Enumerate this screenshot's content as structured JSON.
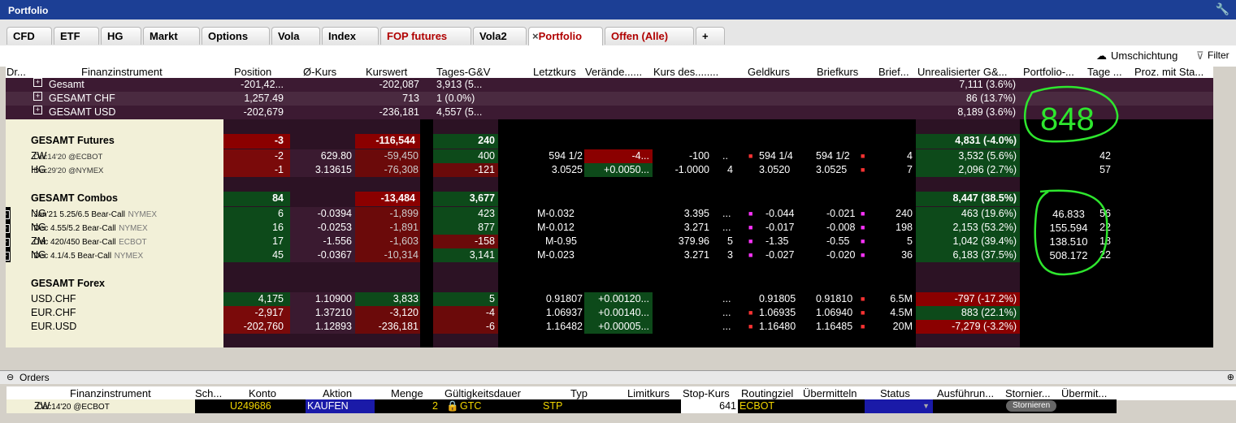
{
  "window": {
    "title": "Portfolio",
    "wrench_icon": "wrench-icon"
  },
  "tabs": [
    {
      "label": "CFD"
    },
    {
      "label": "ETF"
    },
    {
      "label": "HG"
    },
    {
      "label": "Markt"
    },
    {
      "label": "Options"
    },
    {
      "label": "Vola"
    },
    {
      "label": "Index"
    },
    {
      "label": "FOP futures"
    },
    {
      "label": "Vola2"
    },
    {
      "label": "Portfolio"
    },
    {
      "label": "Offen (Alle)"
    },
    {
      "label": "+"
    }
  ],
  "toolbar": {
    "umschichtung": "Umschichtung",
    "filter": "Filter"
  },
  "columns": [
    "Dr...",
    "Finanzinstrument",
    "Position",
    "Ø-Kurs",
    "Kurswert",
    "Tages-G&V",
    "Letztkurs",
    "Verände......",
    "Kurs des........",
    "Geldkurs",
    "Briefkurs",
    "Brief...",
    "Unrealisierter G&...",
    "Portfolio-...",
    "Tage ...",
    "Proz. mit Sta..."
  ],
  "summary": [
    {
      "label": "Gesamt",
      "position": "-201,42...",
      "kurswert": "-202,087",
      "tages": "3,913 (5...",
      "unreal": "7,111 (3.6%)"
    },
    {
      "label": "GESAMT   CHF",
      "position": "1,257.49",
      "kurswert": "713",
      "tages": "1 (0.0%)",
      "unreal": "86 (13.7%)"
    },
    {
      "label": "GESAMT   USD",
      "position": "-202,679",
      "kurswert": "-236,181",
      "tages": "4,557 (5...",
      "unreal": "8,189 (3.6%)"
    }
  ],
  "futures": {
    "title": "GESAMT Futures",
    "position": "-3",
    "kurswert": "-116,544",
    "tages": "240",
    "unreal": "4,831 (-4.0%)",
    "rows": [
      {
        "sym": "ZW",
        "desc": "Dec14'20 @ECBOT",
        "pos": "-2",
        "avg": "629.80",
        "kw": "-59,450",
        "tg": "400",
        "last": "594 1/2",
        "chg": "-4...",
        "kd": "-100",
        "bid": "594 1/4",
        "ask": "594 1/2",
        "bs": "4",
        "unreal": "3,532 (5.6%)",
        "tage": "42"
      },
      {
        "sym": "HG",
        "desc": "Dec29'20 @NYMEX",
        "pos": "-1",
        "avg": "3.13615",
        "kw": "-76,308",
        "tg": "-121",
        "last": "3.0525",
        "chg": "+0.0050...",
        "kd": "-1.0000",
        "kd2": "4",
        "bid": "3.0520",
        "ask": "3.0525",
        "bs": "7",
        "unreal": "2,096 (2.7%)",
        "tage": "57"
      }
    ]
  },
  "combos": {
    "title": "GESAMT Combos",
    "position": "84",
    "kurswert": "-13,484",
    "tages": "3,677",
    "unreal": "8,447 (38.5%)",
    "rows": [
      {
        "sym": "NG",
        "desc": "Jan'21 5.25/6.5 Bear-Call",
        "ex": "NYMEX",
        "pos": "6",
        "avg": "-0.0394",
        "kw": "-1,899",
        "tg": "423",
        "last": "M-0.032",
        "kd": "3.395",
        "kd2": "...",
        "bid": "-0.044",
        "ask": "-0.021",
        "bs": "240",
        "unreal": "463 (19.6%)",
        "tage": "56"
      },
      {
        "sym": "NG",
        "desc": "Dec 4.55/5.2 Bear-Call",
        "ex": "NYMEX",
        "pos": "16",
        "avg": "-0.0253",
        "kw": "-1,891",
        "tg": "877",
        "last": "M-0.012",
        "kd": "3.271",
        "kd2": "...",
        "bid": "-0.017",
        "ask": "-0.008",
        "bs": "198",
        "unreal": "2,153 (53.2%)",
        "tage": "22"
      },
      {
        "sym": "ZM",
        "desc": "Dec 420/450 Bear-Call",
        "ex": "ECBOT",
        "pos": "17",
        "avg": "-1.556",
        "kw": "-1,603",
        "tg": "-158",
        "last": "M-0.95",
        "kd": "379.96",
        "kd2": "5",
        "bid": "-1.35",
        "ask": "-0.55",
        "bs": "5",
        "unreal": "1,042 (39.4%)",
        "tage": "18"
      },
      {
        "sym": "NG",
        "desc": "Dec 4.1/4.5 Bear-Call",
        "ex": "NYMEX",
        "pos": "45",
        "avg": "-0.0367",
        "kw": "-10,314",
        "tg": "3,141",
        "last": "M-0.023",
        "kd": "3.271",
        "kd2": "3",
        "bid": "-0.027",
        "ask": "-0.020",
        "bs": "36",
        "unreal": "6,183 (37.5%)",
        "tage": "22"
      }
    ]
  },
  "forex": {
    "title": "GESAMT Forex",
    "rows": [
      {
        "sym": "USD.CHF",
        "pos": "4,175",
        "avg": "1.10900",
        "kw": "3,833",
        "tg": "5",
        "last": "0.91807",
        "chg": "+0.00120...",
        "kd2": "...",
        "bid": "0.91805",
        "ask": "0.91810",
        "bs": "6.5M",
        "unreal": "-797 (-17.2%)"
      },
      {
        "sym": "EUR.CHF",
        "pos": "-2,917",
        "avg": "1.37210",
        "kw": "-3,120",
        "tg": "-4",
        "last": "1.06937",
        "chg": "+0.00140...",
        "kd2": "...",
        "bid": "1.06935",
        "ask": "1.06940",
        "bs": "4.5M",
        "unreal": "883 (22.1%)"
      },
      {
        "sym": "EUR.USD",
        "pos": "-202,760",
        "avg": "1.12893",
        "kw": "-236,181",
        "tg": "-6",
        "last": "1.16482",
        "chg": "+0.00005...",
        "kd2": "...",
        "bid": "1.16480",
        "ask": "1.16485",
        "bs": "20M",
        "unreal": "-7,279 (-3.2%)"
      }
    ]
  },
  "annotations": {
    "total": "848",
    "portfolio_values": [
      "46.833",
      "155.594",
      "138.510",
      "508.172"
    ]
  },
  "orders": {
    "title": "Orders",
    "columns": [
      "Finanzinstrument",
      "Sch...",
      "Konto",
      "Aktion",
      "Menge",
      "Gültigkeitsdauer",
      "Typ",
      "Limitkurs",
      "Stop-Kurs",
      "Routingziel",
      "Übermitteln",
      "Status",
      "Ausführun...",
      "Stornier...",
      "Übermit..."
    ],
    "row": {
      "sym": "ZW",
      "desc": "Dec14'20 @ECBOT",
      "konto": "U249686",
      "aktion": "KAUFEN",
      "menge": "2",
      "dauer": "GTC",
      "typ": "STP",
      "stop": "641",
      "route": "ECBOT",
      "cancel": "Stornieren"
    }
  },
  "colors": {
    "title": "#1c3f95",
    "dark_red": "#8b0000",
    "dark_green": "#0d4a1a",
    "annot_green": "#2ee62e",
    "purple": "#3a1a30"
  }
}
